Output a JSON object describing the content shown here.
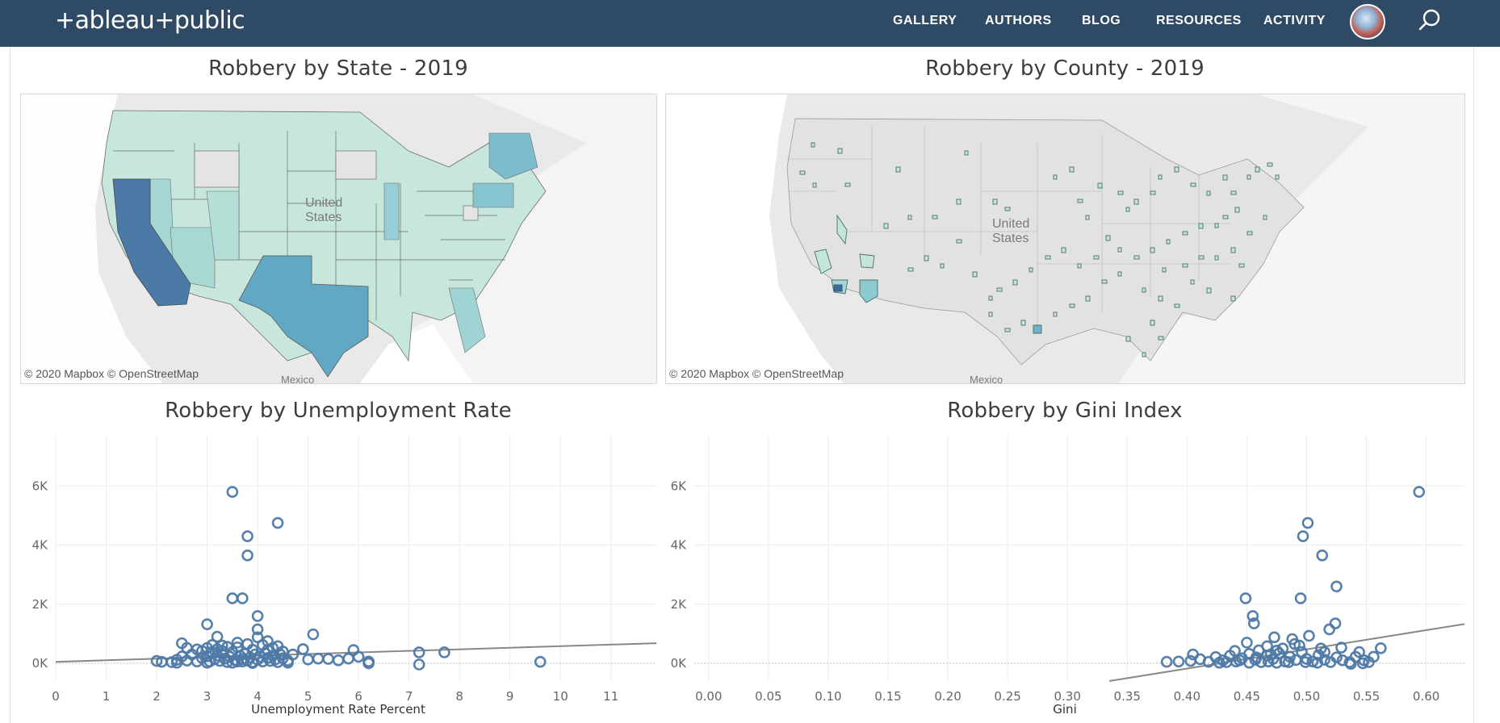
{
  "header": {
    "logo_text": "+ableau+public",
    "nav": [
      "GALLERY",
      "AUTHORS",
      "BLOG",
      "RESOURCES",
      "ACTIVITY"
    ]
  },
  "colors": {
    "nav_bg": "#2f4a64",
    "map_low": "#c4e4dc",
    "map_mid": "#7cbccc",
    "map_high": "#4a7bab",
    "scatter": "#4e79a7",
    "trend": "#888888"
  },
  "maps": {
    "state": {
      "title": "Robbery by State - 2019",
      "attribution": "© 2020 Mapbox  © OpenStreetMap",
      "label_country": "United\nStates",
      "label_mexico": "Mexico"
    },
    "county": {
      "title": "Robbery by County - 2019",
      "attribution": "© 2020 Mapbox  © OpenStreetMap",
      "label_country": "United\nStates",
      "label_mexico": "Mexico"
    }
  },
  "chart_data": [
    {
      "type": "scatter",
      "title": "Robbery by Unemployment Rate",
      "xlabel": "Unemployment Rate Percent",
      "ylabel": "",
      "xlim": [
        0,
        11.9
      ],
      "ylim": [
        -600,
        7700
      ],
      "xticks": [
        "0",
        "1",
        "2",
        "3",
        "4",
        "5",
        "6",
        "7",
        "8",
        "9",
        "10",
        "11"
      ],
      "yticks": [
        {
          "v": 0,
          "label": "0K"
        },
        {
          "v": 2000,
          "label": "2K"
        },
        {
          "v": 4000,
          "label": "4K"
        },
        {
          "v": 6000,
          "label": "6K"
        }
      ],
      "grid": true,
      "trend": [
        [
          0,
          50
        ],
        [
          11.9,
          680
        ]
      ],
      "points": [
        [
          3.5,
          5800
        ],
        [
          4.4,
          4750
        ],
        [
          3.8,
          4300
        ],
        [
          3.8,
          3650
        ],
        [
          3.5,
          2200
        ],
        [
          3.7,
          2200
        ],
        [
          4.0,
          1600
        ],
        [
          3.0,
          1320
        ],
        [
          4.0,
          1150
        ],
        [
          3.2,
          900
        ],
        [
          5.1,
          980
        ],
        [
          4.0,
          880
        ],
        [
          4.2,
          750
        ],
        [
          2.5,
          680
        ],
        [
          3.8,
          650
        ],
        [
          4.4,
          580
        ],
        [
          3.3,
          600
        ],
        [
          2.8,
          470
        ],
        [
          3.6,
          540
        ],
        [
          4.2,
          450
        ],
        [
          4.9,
          480
        ],
        [
          5.9,
          450
        ],
        [
          7.2,
          370
        ],
        [
          7.7,
          370
        ],
        [
          6.0,
          220
        ],
        [
          2.0,
          80
        ],
        [
          2.1,
          50
        ],
        [
          2.3,
          40
        ],
        [
          2.4,
          120
        ],
        [
          2.5,
          230
        ],
        [
          2.6,
          90
        ],
        [
          2.7,
          300
        ],
        [
          2.8,
          60
        ],
        [
          2.9,
          180
        ],
        [
          3.0,
          240
        ],
        [
          3.05,
          60
        ],
        [
          3.1,
          380
        ],
        [
          3.15,
          140
        ],
        [
          3.2,
          260
        ],
        [
          3.25,
          80
        ],
        [
          3.3,
          320
        ],
        [
          3.35,
          160
        ],
        [
          3.4,
          40
        ],
        [
          3.45,
          220
        ],
        [
          3.5,
          380
        ],
        [
          3.55,
          110
        ],
        [
          3.6,
          60
        ],
        [
          3.65,
          260
        ],
        [
          3.7,
          150
        ],
        [
          3.75,
          320
        ],
        [
          3.8,
          90
        ],
        [
          3.85,
          200
        ],
        [
          3.9,
          40
        ],
        [
          3.95,
          300
        ],
        [
          4.0,
          120
        ],
        [
          4.05,
          220
        ],
        [
          4.1,
          60
        ],
        [
          4.15,
          340
        ],
        [
          4.2,
          180
        ],
        [
          4.25,
          80
        ],
        [
          4.3,
          260
        ],
        [
          4.35,
          130
        ],
        [
          4.4,
          40
        ],
        [
          4.45,
          300
        ],
        [
          4.5,
          170
        ],
        [
          4.6,
          90
        ],
        [
          4.7,
          300
        ],
        [
          5.0,
          130
        ],
        [
          5.2,
          160
        ],
        [
          5.4,
          150
        ],
        [
          5.6,
          100
        ],
        [
          5.8,
          160
        ],
        [
          6.2,
          60
        ],
        [
          6.2,
          0
        ],
        [
          7.2,
          -40
        ],
        [
          9.6,
          50
        ],
        [
          3.1,
          620
        ],
        [
          3.3,
          420
        ],
        [
          3.6,
          700
        ],
        [
          4.5,
          400
        ],
        [
          2.9,
          420
        ],
        [
          3.9,
          460
        ],
        [
          4.3,
          520
        ],
        [
          3.4,
          560
        ],
        [
          2.6,
          520
        ],
        [
          3.0,
          520
        ],
        [
          3.2,
          480
        ],
        [
          4.1,
          620
        ],
        [
          3.7,
          60
        ],
        [
          3.5,
          20
        ],
        [
          2.4,
          20
        ],
        [
          4.6,
          20
        ],
        [
          3.0,
          20
        ],
        [
          3.9,
          10
        ]
      ]
    },
    {
      "type": "scatter",
      "title": "Robbery by Gini Index",
      "xlabel": "Gini",
      "ylabel": "",
      "xlim": [
        -0.012,
        0.632
      ],
      "ylim": [
        -600,
        7700
      ],
      "xticks": [
        "0.00",
        "0.05",
        "0.10",
        "0.15",
        "0.20",
        "0.25",
        "0.30",
        "0.35",
        "0.40",
        "0.45",
        "0.50",
        "0.55",
        "0.60"
      ],
      "yticks": [
        {
          "v": 0,
          "label": "0K"
        },
        {
          "v": 2000,
          "label": "2K"
        },
        {
          "v": 4000,
          "label": "4K"
        },
        {
          "v": 6000,
          "label": "6K"
        }
      ],
      "grid": true,
      "trend": [
        [
          0.335,
          -600
        ],
        [
          0.632,
          1330
        ]
      ],
      "points": [
        [
          0.594,
          5800
        ],
        [
          0.501,
          4750
        ],
        [
          0.497,
          4300
        ],
        [
          0.513,
          3650
        ],
        [
          0.525,
          2600
        ],
        [
          0.449,
          2200
        ],
        [
          0.495,
          2200
        ],
        [
          0.455,
          1600
        ],
        [
          0.456,
          1350
        ],
        [
          0.524,
          1350
        ],
        [
          0.519,
          1150
        ],
        [
          0.502,
          930
        ],
        [
          0.473,
          880
        ],
        [
          0.488,
          820
        ],
        [
          0.45,
          700
        ],
        [
          0.467,
          580
        ],
        [
          0.529,
          530
        ],
        [
          0.512,
          500
        ],
        [
          0.475,
          430
        ],
        [
          0.494,
          600
        ],
        [
          0.562,
          510
        ],
        [
          0.44,
          420
        ],
        [
          0.544,
          380
        ],
        [
          0.405,
          300
        ],
        [
          0.548,
          100
        ],
        [
          0.383,
          50
        ],
        [
          0.393,
          60
        ],
        [
          0.403,
          80
        ],
        [
          0.411,
          140
        ],
        [
          0.418,
          50
        ],
        [
          0.424,
          210
        ],
        [
          0.43,
          100
        ],
        [
          0.436,
          260
        ],
        [
          0.441,
          60
        ],
        [
          0.446,
          170
        ],
        [
          0.452,
          320
        ],
        [
          0.457,
          120
        ],
        [
          0.462,
          40
        ],
        [
          0.467,
          260
        ],
        [
          0.472,
          150
        ],
        [
          0.477,
          340
        ],
        [
          0.482,
          60
        ],
        [
          0.486,
          220
        ],
        [
          0.491,
          110
        ],
        [
          0.496,
          380
        ],
        [
          0.5,
          150
        ],
        [
          0.505,
          60
        ],
        [
          0.51,
          280
        ],
        [
          0.515,
          120
        ],
        [
          0.52,
          40
        ],
        [
          0.525,
          200
        ],
        [
          0.53,
          100
        ],
        [
          0.536,
          40
        ],
        [
          0.541,
          220
        ],
        [
          0.547,
          0
        ],
        [
          0.552,
          40
        ],
        [
          0.556,
          220
        ],
        [
          0.537,
          -20
        ],
        [
          0.46,
          440
        ],
        [
          0.48,
          500
        ],
        [
          0.49,
          650
        ],
        [
          0.47,
          300
        ],
        [
          0.458,
          200
        ],
        [
          0.444,
          100
        ],
        [
          0.433,
          40
        ],
        [
          0.485,
          40
        ],
        [
          0.499,
          40
        ],
        [
          0.509,
          20
        ],
        [
          0.468,
          60
        ],
        [
          0.475,
          20
        ],
        [
          0.452,
          20
        ],
        [
          0.427,
          20
        ],
        [
          0.515,
          380
        ]
      ]
    }
  ]
}
